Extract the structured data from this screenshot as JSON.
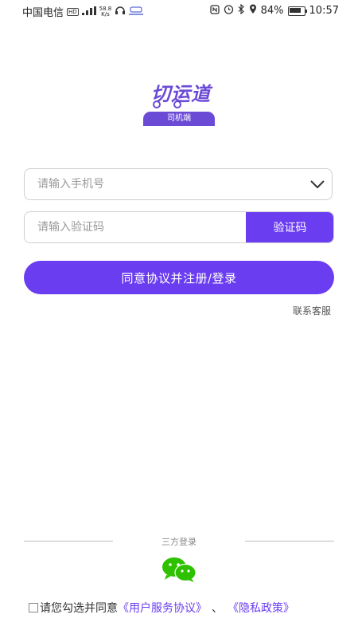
{
  "status_bar": {
    "carrier": "中国电信",
    "network": "HD",
    "signal": "4G",
    "speed_value": "58.8",
    "speed_unit": "K/s",
    "battery": "84%",
    "time": "10:57"
  },
  "logo": {
    "text": "切运道",
    "badge": "司机端"
  },
  "form": {
    "phone_placeholder": "请输入手机号",
    "code_placeholder": "请输入验证码",
    "code_button": "验证码",
    "submit_button": "同意协议并注册/登录",
    "contact_link": "联系客服"
  },
  "third_party": {
    "label": "三方登录",
    "wechat_icon": "wechat-icon"
  },
  "agreement": {
    "prefix": "请您勾选并同意",
    "user_agreement": "《用户服务协议》",
    "separator": "、",
    "privacy_policy": "《隐私政策》"
  },
  "colors": {
    "accent": "#6b3df0",
    "wechat": "#2dc100"
  }
}
